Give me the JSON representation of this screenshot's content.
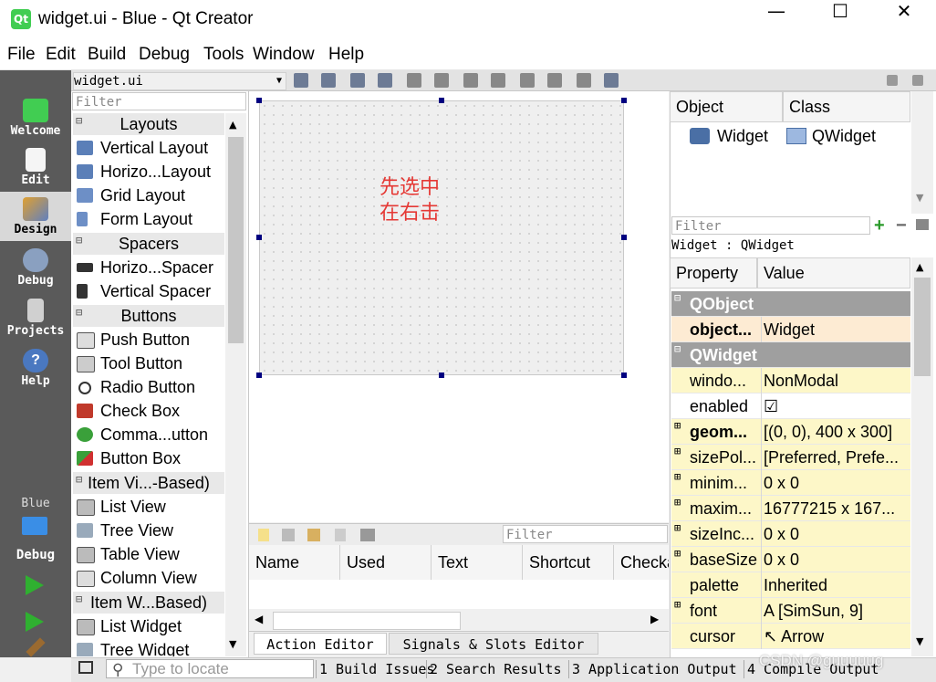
{
  "window": {
    "title": "widget.ui - Blue - Qt Creator",
    "app_icon": "Qt",
    "minimize": "—",
    "maximize": "☐",
    "close": "✕"
  },
  "menu": [
    "File",
    "Edit",
    "Build",
    "Debug",
    "Tools",
    "Window",
    "Help"
  ],
  "modes": [
    {
      "label": "Welcome",
      "icon": "qt-logo-icon"
    },
    {
      "label": "Edit",
      "icon": "edit-document-icon"
    },
    {
      "label": "Design",
      "icon": "design-pencil-icon"
    },
    {
      "label": "Debug",
      "icon": "debug-bug-icon"
    },
    {
      "label": "Projects",
      "icon": "projects-icon"
    },
    {
      "label": "Help",
      "icon": "help-icon"
    }
  ],
  "kit": {
    "project": "Blue",
    "build": "Debug"
  },
  "editor": {
    "file": "widget.ui"
  },
  "widget_box": {
    "filter_placeholder": "Filter",
    "layouts": {
      "title": "Layouts",
      "items": [
        "Vertical Layout",
        "Horizo...Layout",
        "Grid Layout",
        "Form Layout"
      ]
    },
    "spacers": {
      "title": "Spacers",
      "items": [
        "Horizo...Spacer",
        "Vertical Spacer"
      ]
    },
    "buttons": {
      "title": "Buttons",
      "items": [
        "Push Button",
        "Tool Button",
        "Radio Button",
        "Check Box",
        "Comma...utton",
        "Button Box"
      ]
    },
    "item_views": {
      "title": "Item Vi...-Based)",
      "items": [
        "List View",
        "Tree View",
        "Table View",
        "Column View"
      ]
    },
    "item_widgets": {
      "title": "Item W...Based)",
      "items": [
        "List Widget",
        "Tree Widget"
      ]
    }
  },
  "form": {
    "annotation": "先选中\n在右击"
  },
  "action_editor": {
    "filter_placeholder": "Filter",
    "columns": [
      "Name",
      "Used",
      "Text",
      "Shortcut",
      "Checka"
    ],
    "tabs": [
      "Action Editor",
      "Signals & Slots Editor"
    ]
  },
  "object_inspector": {
    "headers": [
      "Object",
      "Class"
    ],
    "row": {
      "object": "Widget",
      "class": "QWidget"
    }
  },
  "property_editor": {
    "filter_placeholder": "Filter",
    "context": "Widget : QWidget",
    "headers": [
      "Property",
      "Value"
    ],
    "rows": [
      {
        "name": "QObject",
        "group": true
      },
      {
        "name": "object...",
        "value": "Widget"
      },
      {
        "name": "QWidget",
        "group": true
      },
      {
        "name": "windo...",
        "value": "NonModal"
      },
      {
        "name": "enabled",
        "value": "☑"
      },
      {
        "name": "geom...",
        "value": "[(0, 0), 400 x 300]"
      },
      {
        "name": "sizePol...",
        "value": "[Preferred, Prefe..."
      },
      {
        "name": "minim...",
        "value": "0 x 0"
      },
      {
        "name": "maxim...",
        "value": "16777215 x 167..."
      },
      {
        "name": "sizeInc...",
        "value": "0 x 0"
      },
      {
        "name": "baseSize",
        "value": "0 x 0"
      },
      {
        "name": "palette",
        "value": "Inherited"
      },
      {
        "name": "font",
        "value": "A  [SimSun, 9]"
      },
      {
        "name": "cursor",
        "value": "↖  Arrow"
      }
    ]
  },
  "statusbar": {
    "locate_placeholder": "Type to locate",
    "panes": [
      "1 Build Issues",
      "2 Search Results",
      "3 Application Output",
      "4 Compile Output"
    ],
    "watermark": "CSDN @guuuuug"
  }
}
